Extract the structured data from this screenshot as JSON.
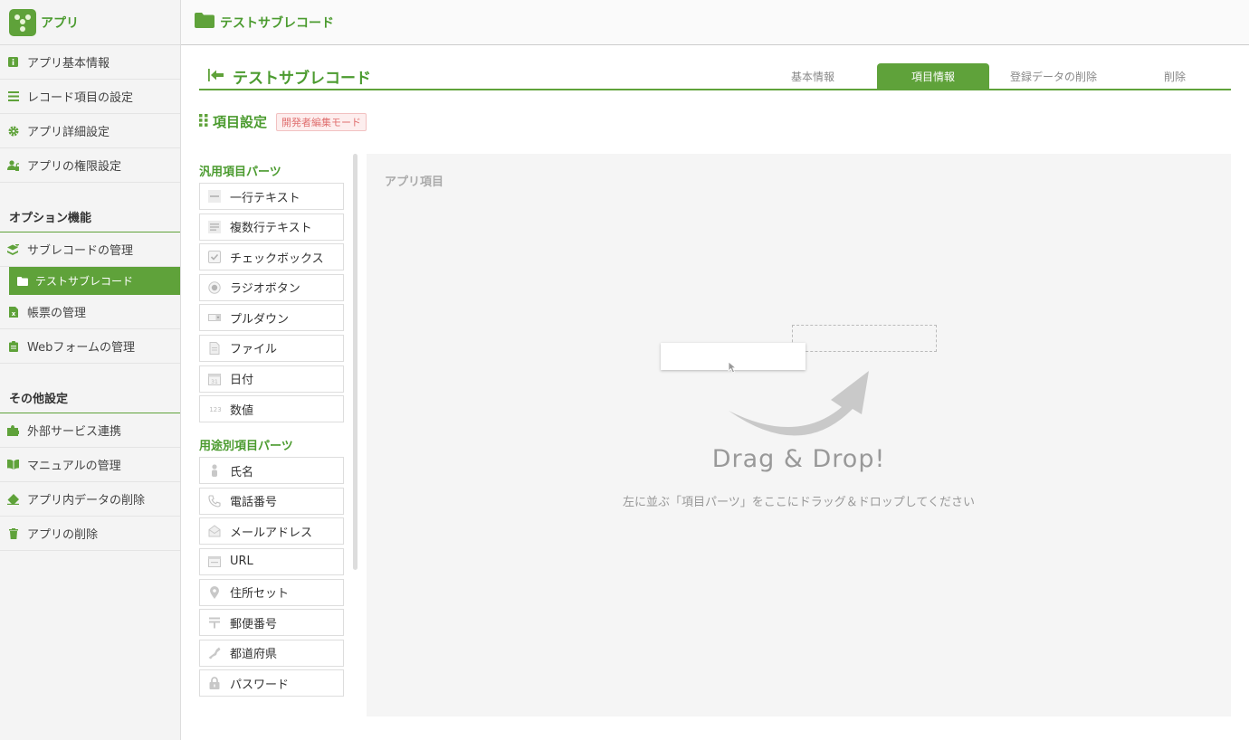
{
  "app": {
    "name": "アプリ"
  },
  "topbar": {
    "title": "テストサブレコード"
  },
  "sidebar": {
    "main_items": [
      {
        "label": "アプリ基本情報",
        "icon": "info-icon"
      },
      {
        "label": "レコード項目の設定",
        "icon": "list-icon"
      },
      {
        "label": "アプリ詳細設定",
        "icon": "gear-icon"
      },
      {
        "label": "アプリの権限設定",
        "icon": "user-lock-icon"
      }
    ],
    "option_section": "オプション機能",
    "option_items": [
      {
        "label": "サブレコードの管理",
        "icon": "layers-icon"
      },
      {
        "label": "帳票の管理",
        "icon": "excel-icon"
      },
      {
        "label": "Webフォームの管理",
        "icon": "clipboard-icon"
      }
    ],
    "active_sub": {
      "label": "テストサブレコード",
      "icon": "folder-icon"
    },
    "other_section": "その他設定",
    "other_items": [
      {
        "label": "外部サービス連携",
        "icon": "puzzle-icon"
      },
      {
        "label": "マニュアルの管理",
        "icon": "book-icon"
      },
      {
        "label": "アプリ内データの削除",
        "icon": "eraser-icon"
      },
      {
        "label": "アプリの削除",
        "icon": "trash-icon"
      }
    ]
  },
  "page": {
    "title": "テストサブレコード",
    "tabs": [
      {
        "label": "基本情報",
        "active": false
      },
      {
        "label": "項目情報",
        "active": true
      },
      {
        "label": "登録データの削除",
        "active": false
      },
      {
        "label": "削除",
        "active": false
      }
    ]
  },
  "section": {
    "title": "項目設定",
    "badge": "開発者編集モード"
  },
  "parts": {
    "general_heading": "汎用項目パーツ",
    "general": [
      {
        "label": "一行テキスト",
        "icon": "single-line-text-icon"
      },
      {
        "label": "複数行テキスト",
        "icon": "multi-line-text-icon"
      },
      {
        "label": "チェックボックス",
        "icon": "checkbox-icon"
      },
      {
        "label": "ラジオボタン",
        "icon": "radio-icon"
      },
      {
        "label": "プルダウン",
        "icon": "pulldown-icon"
      },
      {
        "label": "ファイル",
        "icon": "file-icon"
      },
      {
        "label": "日付",
        "icon": "calendar-icon"
      },
      {
        "label": "数値",
        "icon": "number-icon"
      }
    ],
    "purpose_heading": "用途別項目パーツ",
    "purpose": [
      {
        "label": "氏名",
        "icon": "person-icon"
      },
      {
        "label": "電話番号",
        "icon": "phone-icon"
      },
      {
        "label": "メールアドレス",
        "icon": "mail-icon"
      },
      {
        "label": "URL",
        "icon": "url-icon"
      },
      {
        "label": "住所セット",
        "icon": "map-pin-icon"
      },
      {
        "label": "郵便番号",
        "icon": "postal-icon"
      },
      {
        "label": "都道府県",
        "icon": "japan-map-icon"
      },
      {
        "label": "パスワード",
        "icon": "lock-icon"
      }
    ]
  },
  "dropzone": {
    "label": "アプリ項目",
    "title": "Drag & Drop!",
    "subtitle": "左に並ぶ「項目パーツ」をここにドラッグ＆ドロップしてください"
  },
  "colors": {
    "accent": "#5fa23a",
    "accent_text": "#4b9b2f",
    "badge_text": "#e07070"
  }
}
